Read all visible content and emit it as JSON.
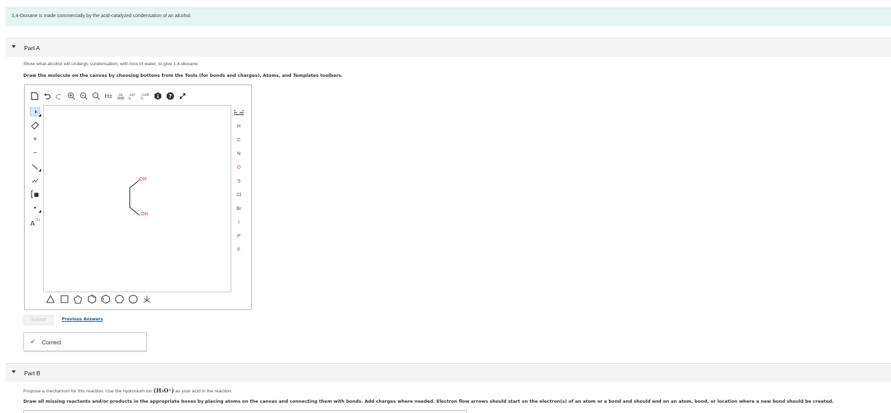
{
  "intro_text": "1,4-Dioxane is made commercially by the acid-catalyzed condensation of an alcohol.",
  "partA": {
    "title": "Part A",
    "instruction": "Show what alcohol will undergo condensation, with loss of water, to give 1,4-dioxane.",
    "drawing_instruction": "Draw the molecule on the canvas by choosing buttons from the Tools (for bonds and charges), Atoms, and Templates toolbars."
  },
  "editor": {
    "top_toolbar_icons": [
      "new-document-icon",
      "undo-icon",
      "redo-icon",
      "zoom-in-icon",
      "zoom-out-icon",
      "zoom-reset-icon",
      "explicit-hydrogens-icon",
      "2d-clean-icon",
      "expand-icon",
      "contract-icon",
      "info-icon",
      "help-icon",
      "fullscreen-icon"
    ],
    "left_tools": [
      "select-icon",
      "eraser-icon",
      "positive-charge-icon",
      "negative-charge-icon",
      "single-bond-icon",
      "chain-icon",
      "bracket-icon",
      "radical-icon",
      "atom-label-icon"
    ],
    "hydrogens_label": "H±",
    "right_atoms": [
      "H",
      "C",
      "N",
      "O",
      "S",
      "Cl",
      "Br",
      "I",
      "P",
      "F"
    ],
    "oxygen_color": "#e03030",
    "templates": [
      "cyclopropane-icon",
      "cyclobutane-icon",
      "cyclopentane-icon",
      "benzene-icon",
      "cyclohexane-icon",
      "cycloheptane-icon",
      "cyclooctane-icon",
      "lone-pair-icon"
    ],
    "molecule_labels": {
      "oh_top": "OH",
      "oh_bottom": "OH"
    }
  },
  "submit_label": "Submit",
  "previous_answers_label": "Previous Answers",
  "feedback": {
    "label": "Correct",
    "color": "#3a9a2f"
  },
  "partB": {
    "title": "Part B",
    "instruction_pre": "Propose a mechanism for this reaction. Use the hydronium ion",
    "hydronium_formula": "(H₃O⁺)",
    "instruction_post": "as your acid in the reaction.",
    "drawing_instruction": "Draw all missing reactants and/or products in the appropriate boxes by placing atoms on the canvas and connecting them with bonds. Add charges where needed. Electron flow arrows should start on the electron(s) of an atom or a bond and should end on an atom, bond, or location where a new bond should be created."
  }
}
